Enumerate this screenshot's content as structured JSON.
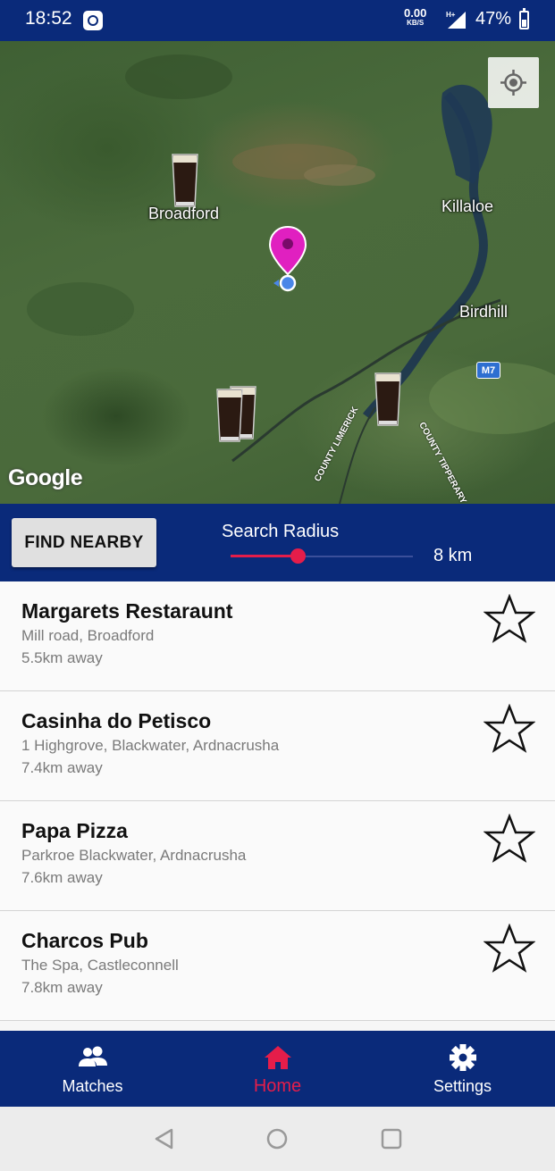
{
  "status_bar": {
    "time": "18:52",
    "net_speed": "0.00",
    "net_unit": "KB/S",
    "network_type": "H+",
    "battery_percent": "47%"
  },
  "map": {
    "labels": {
      "broadford": "Broadford",
      "killaloe": "Killaloe",
      "birdhill": "Birdhill",
      "county_limerick": "COUNTY LIMERICK",
      "county_tipperary": "COUNTY TIPPERARY"
    },
    "road_badge": "M7",
    "attribution": "Google",
    "icons": {
      "locate": "my-location-icon",
      "pin": "location-pin-icon",
      "pub": "pint-glass-icon"
    }
  },
  "controls": {
    "find_button": "FIND NEARBY",
    "radius_label": "Search Radius",
    "radius_value": "8 km",
    "slider_fraction": 0.37
  },
  "results": [
    {
      "name": "Margarets Restaraunt",
      "address": "Mill road, Broadford",
      "distance": "5.5km away"
    },
    {
      "name": "Casinha do Petisco",
      "address": "1 Highgrove, Blackwater, Ardnacrusha",
      "distance": "7.4km away"
    },
    {
      "name": "Papa Pizza",
      "address": "Parkroe Blackwater, Ardnacrusha",
      "distance": "7.6km away"
    },
    {
      "name": "Charcos Pub",
      "address": "The Spa, Castleconnell",
      "distance": "7.8km away"
    }
  ],
  "bottom_nav": {
    "matches": "Matches",
    "home": "Home",
    "settings": "Settings",
    "active": "home"
  },
  "colors": {
    "primary": "#0a2a7a",
    "accent": "#e51d4a",
    "pin": "#e020c0"
  }
}
